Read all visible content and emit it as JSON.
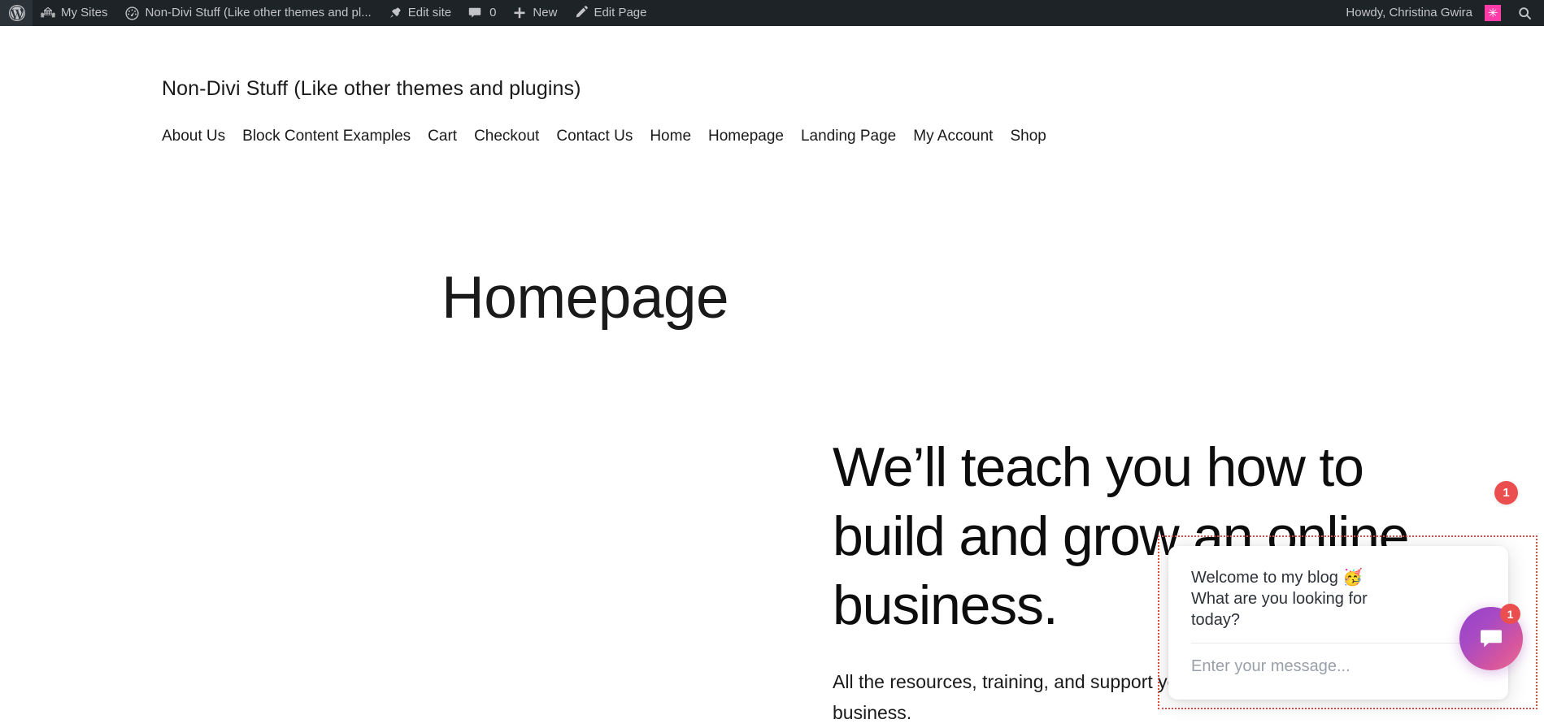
{
  "admin_bar": {
    "wp_logo_icon": "wordpress-logo-icon",
    "items": [
      {
        "label": "My Sites",
        "icon": "my-sites-buildings-icon",
        "name": "admin-bar-my-sites"
      },
      {
        "label": "Non-Divi Stuff (Like other themes and pl...",
        "icon": "dashboard-gauge-icon",
        "name": "admin-bar-site-name"
      },
      {
        "label": "Edit site",
        "icon": "pushpin-icon",
        "name": "admin-bar-edit-site"
      },
      {
        "label": "0",
        "icon": "comment-bubble-icon",
        "name": "admin-bar-comments"
      },
      {
        "label": "New",
        "icon": "plus-icon",
        "name": "admin-bar-new"
      },
      {
        "label": "Edit Page",
        "icon": "pencil-icon",
        "name": "admin-bar-edit-page"
      }
    ],
    "howdy": "Howdy, Christina Gwira",
    "avatar_glyph": "✳",
    "avatar_color": "#ff3ba7",
    "search_icon": "search-magnifier-icon",
    "background_color": "#1d2327"
  },
  "site": {
    "title": "Non-Divi Stuff (Like other themes and plugins)",
    "nav": [
      "About Us",
      "Block Content Examples",
      "Cart",
      "Checkout",
      "Contact Us",
      "Home",
      "Homepage",
      "Landing Page",
      "My Account",
      "Shop"
    ]
  },
  "page": {
    "title": "Homepage",
    "hero_heading": "We’ll teach you how to build and grow an online business.",
    "hero_subtext": "All the resources, training, and support you need to run your dream online business."
  },
  "chat_widget": {
    "greeting": "Welcome to my blog 🥳\nWhat are you looking for today?",
    "input_placeholder": "Enter your message...",
    "launcher_icon": "chat-bubble-icon",
    "launcher_badge_count": "1",
    "floating_badge_count": "1",
    "badge_color": "#ea4e4e",
    "launcher_gradient_from": "#9543cb",
    "launcher_gradient_to": "#ec6f90",
    "selection_outline_color": "#e04b4b"
  }
}
